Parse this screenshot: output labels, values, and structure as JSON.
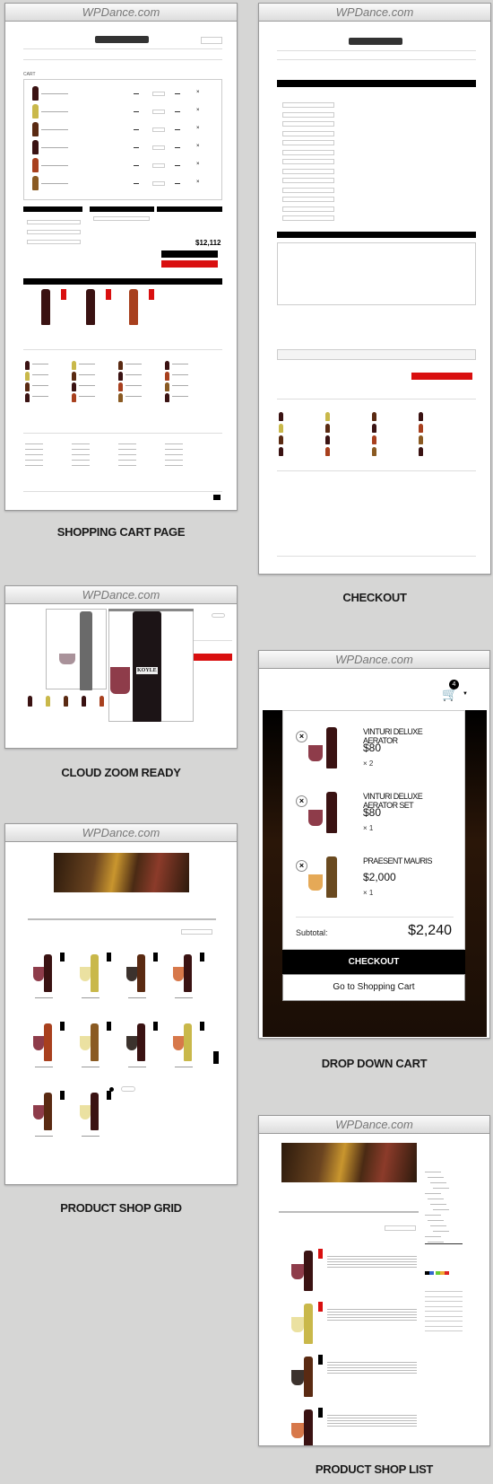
{
  "site_bar": "WPDance.com",
  "labels": {
    "cart": "SHOPPING CART PAGE",
    "checkout": "CHECKOUT",
    "zoom": "CLOUD ZOOM READY",
    "dropdown": "DROP DOWN CART",
    "grid": "PRODUCT SHOP GRID",
    "list": "PRODUCT SHOP LIST"
  },
  "cart_page": {
    "total": "$12,112",
    "title": "CART"
  },
  "zoom_page": {
    "brand_on_label": "KOYLE"
  },
  "dropdown_cart": {
    "count": "4",
    "items": [
      {
        "name": "VINTURI DELUXE AERATOR",
        "price": "$80",
        "qty": "× 2"
      },
      {
        "name": "VINTURI DELUXE AERATOR SET",
        "price": "$80",
        "qty": "× 1"
      },
      {
        "name": "PRAESENT MAURIS",
        "price": "$2,000",
        "qty": "× 1"
      }
    ],
    "subtotal_label": "Subtotal:",
    "subtotal": "$2,240",
    "checkout": "CHECKOUT",
    "go_cart": "Go to Shopping Cart"
  },
  "colors": {
    "accent": "#d90f0f",
    "dark": "#000000",
    "bg": "#d6d6d5"
  }
}
